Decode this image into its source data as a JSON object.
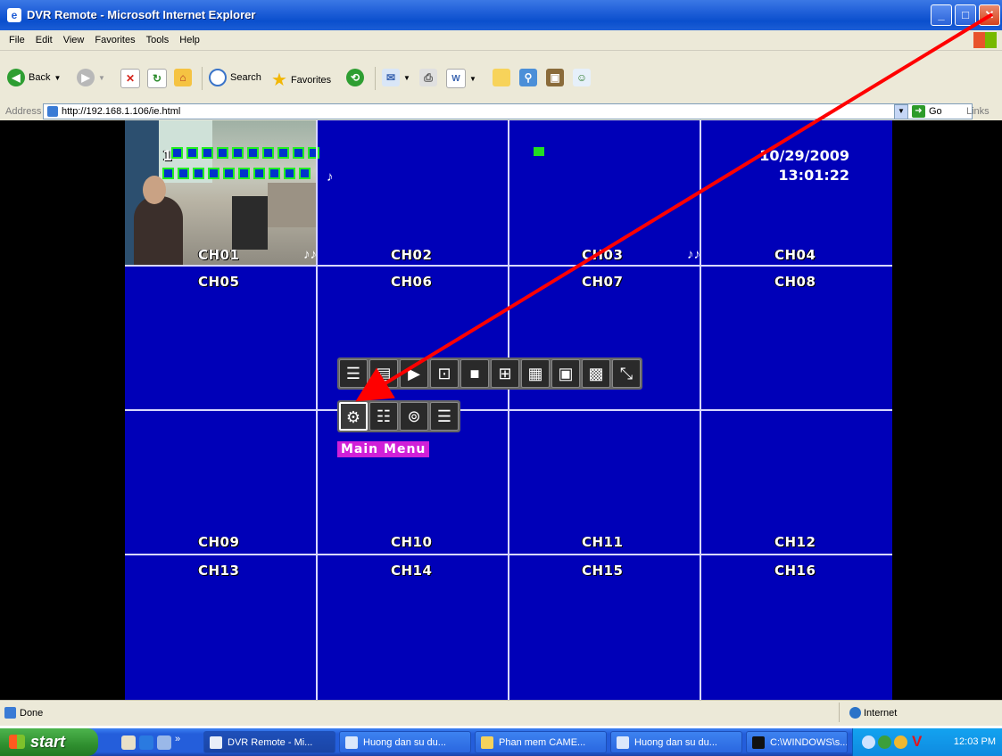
{
  "window": {
    "title": "DVR Remote - Microsoft Internet Explorer",
    "min_label": "_",
    "max_label": "□",
    "close_label": "✕"
  },
  "menubar": {
    "items": [
      "File",
      "Edit",
      "View",
      "Favorites",
      "Tools",
      "Help"
    ]
  },
  "toolbar": {
    "back_label": "Back",
    "search_label": "Search",
    "favorites_label": "Favorites"
  },
  "address": {
    "label": "Address",
    "url": "http://192.168.1.106/ie.html",
    "go_label": "Go",
    "links_label": "Links"
  },
  "dvr": {
    "date": "10/29/2009",
    "time": "13:01:22",
    "ch1_marker": "1",
    "channels": [
      "CH01",
      "CH02",
      "CH03",
      "CH04",
      "CH05",
      "CH06",
      "CH07",
      "CH08",
      "CH09",
      "CH10",
      "CH11",
      "CH12",
      "CH13",
      "CH14",
      "CH15",
      "CH16"
    ],
    "popup_label": "Main Menu",
    "popup_row1_icons": [
      "channel-list-icon",
      "record-icon",
      "play-icon",
      "monitor-icon",
      "single-view-icon",
      "quad-view-icon",
      "nine-view-icon",
      "thirteen-view-icon",
      "sixteen-view-icon",
      "fullscreen-icon"
    ],
    "popup_row2_icons": [
      "main-menu-gear-icon",
      "search-list-icon",
      "backup-icon",
      "exit-icon"
    ]
  },
  "status": {
    "text": "Done",
    "zone": "Internet"
  },
  "taskbar": {
    "start_label": "start",
    "tasks": [
      "DVR Remote - Mi...",
      "Huong dan su du...",
      "Phan mem CAME...",
      "Huong dan su du...",
      "C:\\WINDOWS\\s..."
    ],
    "clock": "12:03 PM"
  },
  "colors": {
    "dvr_background": "#0000b8",
    "annotation_arrow": "#ff0000",
    "main_menu_label": "#d020d8"
  }
}
